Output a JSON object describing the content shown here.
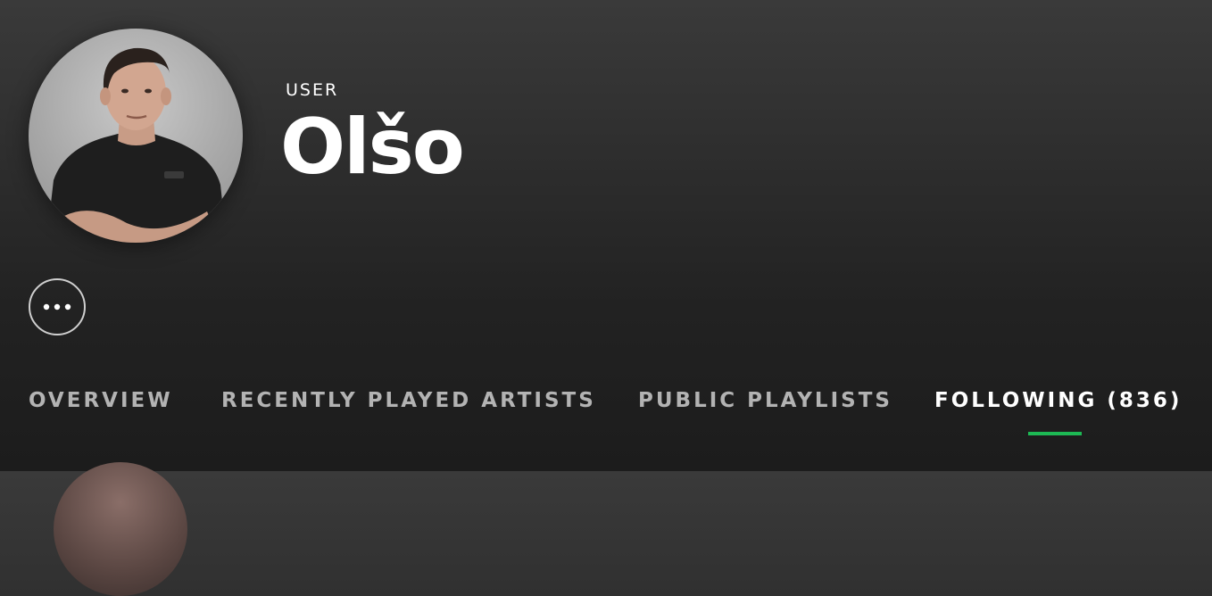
{
  "profile": {
    "type_label": "USER",
    "display_name": "Olšo"
  },
  "actions": {
    "more_icon": "ellipsis-icon"
  },
  "tabs": [
    {
      "label": "OVERVIEW",
      "active": false
    },
    {
      "label": "RECENTLY PLAYED ARTISTS",
      "active": false
    },
    {
      "label": "PUBLIC PLAYLISTS",
      "active": false
    },
    {
      "label": "FOLLOWING (836)",
      "active": true
    }
  ],
  "colors": {
    "accent": "#1db954",
    "text_primary": "#ffffff",
    "text_secondary": "#b3b3b3",
    "background_top": "#3a3a3a",
    "background_bottom": "#1c1c1c"
  }
}
